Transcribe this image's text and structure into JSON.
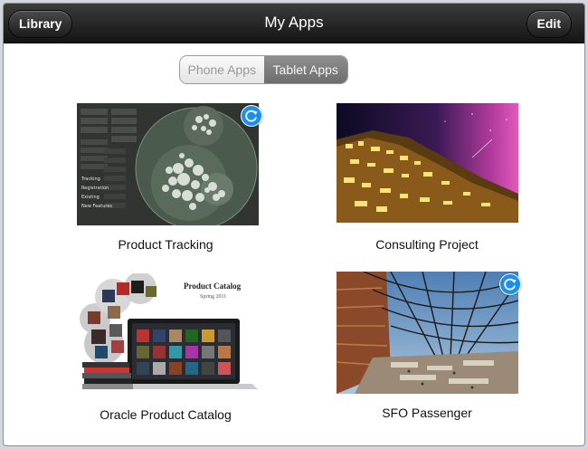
{
  "navbar": {
    "title": "My Apps",
    "left_button": "Library",
    "right_button": "Edit"
  },
  "segmented": {
    "options": [
      "Phone Apps",
      "Tablet Apps"
    ],
    "selected": "Tablet Apps"
  },
  "apps": [
    {
      "name": "Product Tracking",
      "has_sync_badge": true
    },
    {
      "name": "Consulting Project",
      "has_sync_badge": false
    },
    {
      "name": "Oracle Product Catalog",
      "has_sync_badge": false
    },
    {
      "name": "SFO Passenger",
      "has_sync_badge": true
    }
  ],
  "thumbnails": {
    "product_tracking": {
      "sidebar_labels": [
        "Tracking",
        "Registration",
        "Existing",
        "New Features"
      ]
    },
    "oracle_catalog": {
      "heading": "Product Catalog",
      "subheading": "Spring 2011"
    }
  },
  "colors": {
    "navbar": "#1e1e1e",
    "accent_badge": "#1b8ff0",
    "segment_selected": "#7a7a7a"
  }
}
